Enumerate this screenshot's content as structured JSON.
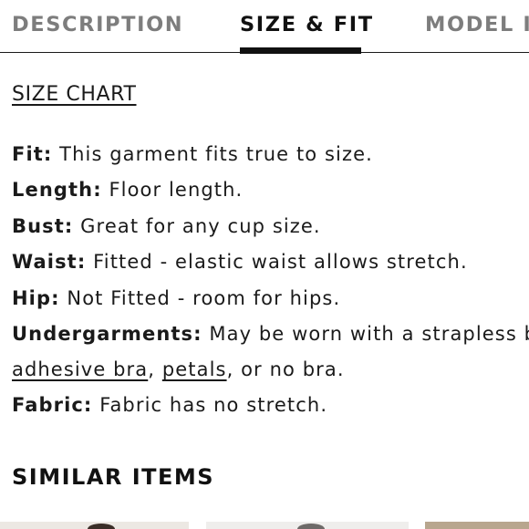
{
  "tabs": [
    {
      "label": "DESCRIPTION",
      "active": false
    },
    {
      "label": "SIZE & FIT",
      "active": true
    },
    {
      "label": "MODEL II",
      "active": false
    }
  ],
  "size_chart_link": "SIZE CHART",
  "specs": {
    "fit": {
      "key": "Fit:",
      "value": " This garment fits true to size."
    },
    "length": {
      "key": "Length:",
      "value": " Floor length."
    },
    "bust": {
      "key": "Bust:",
      "value": " Great for any cup size."
    },
    "waist": {
      "key": "Waist:",
      "value": " Fitted - elastic waist allows stretch."
    },
    "hip": {
      "key": "Hip:",
      "value": " Not Fitted - room for hips."
    },
    "undergarments": {
      "key": "Undergarments:",
      "value": " May be worn with a strapless b",
      "link1": "adhesive bra",
      "sep1": ", ",
      "link2": "petals",
      "tail": ", or no bra."
    },
    "fabric": {
      "key": "Fabric:",
      "value": " Fabric has no stretch."
    }
  },
  "similar_items": {
    "title": "SIMILAR ITEMS"
  },
  "colors": {
    "text": "#1a1a1a",
    "inactive_tab": "#7d7d7d",
    "accent_underline": "#111111"
  }
}
